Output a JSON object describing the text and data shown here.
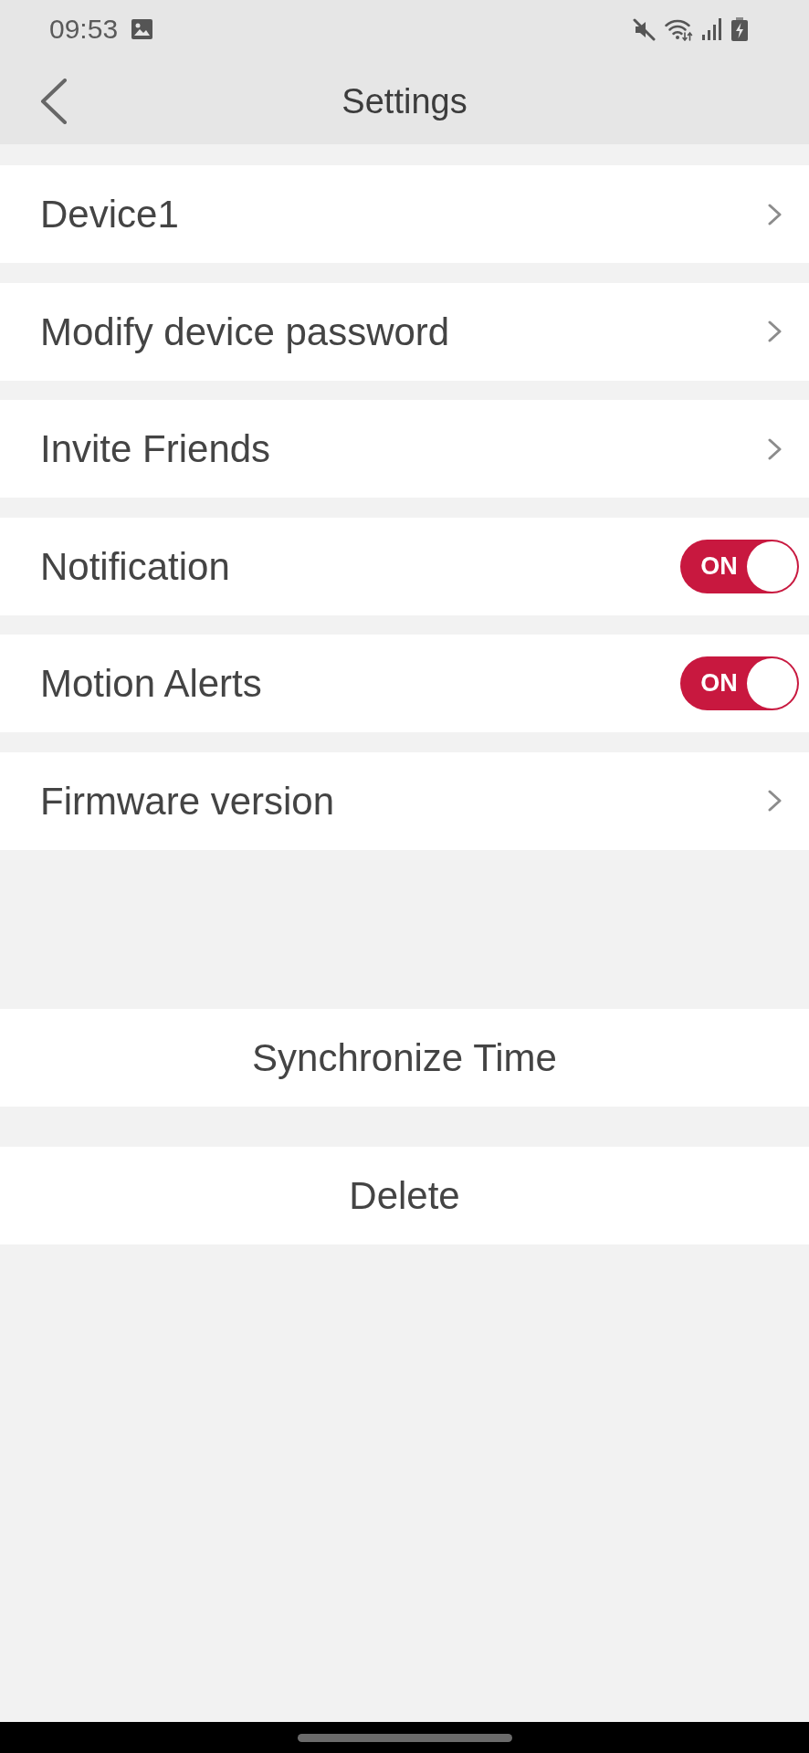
{
  "status_bar": {
    "time": "09:53"
  },
  "header": {
    "title": "Settings"
  },
  "settings": [
    {
      "kind": "link",
      "label": "Device1"
    },
    {
      "kind": "link",
      "label": "Modify device password"
    },
    {
      "kind": "link",
      "label": "Invite Friends"
    },
    {
      "kind": "toggle",
      "label": "Notification",
      "on": true,
      "toggle_label": "ON"
    },
    {
      "kind": "toggle",
      "label": "Motion Alerts",
      "on": true,
      "toggle_label": "ON"
    },
    {
      "kind": "link",
      "label": "Firmware version"
    }
  ],
  "actions": [
    {
      "label": "Synchronize Time"
    },
    {
      "label": "Delete"
    }
  ]
}
